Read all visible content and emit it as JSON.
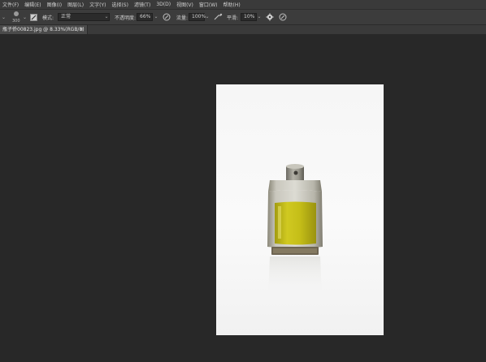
{
  "menu": [
    "文件(F)",
    "编辑(E)",
    "图像(I)",
    "图层(L)",
    "文字(Y)",
    "选择(S)",
    "滤镜(T)",
    "3D(D)",
    "视图(V)",
    "窗口(W)",
    "帮助(H)"
  ],
  "options": {
    "brush_size": "300",
    "mode_label": "模式:",
    "mode_value": "正常",
    "opacity_label": "不透明度:",
    "opacity_value": "66%",
    "flow_label": "流量:",
    "flow_value": "100%",
    "smooth_label": "平滑:",
    "smooth_value": "10%"
  },
  "tab": {
    "title": "瓶子侨00823.jpg @ 8.33%(RGB/8) *",
    "close": "×"
  },
  "colors": {
    "app_bg": "#282828",
    "menubar_bg": "#3a3a3a",
    "optbar_bg": "#3c3c3c",
    "liquid": "#c8c21a"
  },
  "icons": [
    "brush-preset-icon",
    "brush-panel-icon",
    "airbrush-icon",
    "pressure-icon",
    "gear-icon",
    "symmetry-icon"
  ]
}
